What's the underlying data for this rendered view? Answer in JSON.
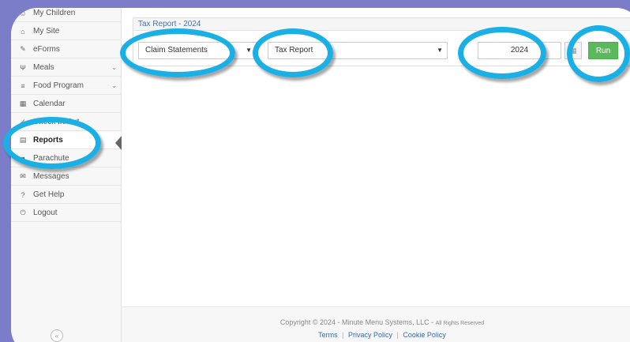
{
  "sidebar": {
    "items": [
      {
        "label": "My Children",
        "icon": "child-icon"
      },
      {
        "label": "My Site",
        "icon": "site-icon"
      },
      {
        "label": "eForms",
        "icon": "edit-icon"
      },
      {
        "label": "Meals",
        "icon": "utensils-icon",
        "expandable": true
      },
      {
        "label": "Food Program",
        "icon": "food-program-icon",
        "expandable": true
      },
      {
        "label": "Calendar",
        "icon": "calendar-icon"
      },
      {
        "label": "Check In/Out",
        "icon": "check-icon"
      },
      {
        "label": "Reports",
        "icon": "report-icon",
        "active": true
      },
      {
        "label": "Parachute",
        "icon": "parachute-icon"
      },
      {
        "label": "Messages",
        "icon": "envelope-icon"
      },
      {
        "label": "Get Help",
        "icon": "help-icon"
      },
      {
        "label": "Logout",
        "icon": "power-icon"
      }
    ],
    "collapse_label": "«"
  },
  "report": {
    "title": "Tax Report - 2024",
    "category_value": "Claim Statements",
    "report_value": "Tax Report",
    "year_value": "2024",
    "run_label": "Run"
  },
  "footer": {
    "copyright": "Copyright © 2024 - Minute Menu Systems, LLC -",
    "rights": "All Rights Reserved",
    "links": {
      "terms": "Terms",
      "privacy": "Privacy Policy",
      "cookie": "Cookie Policy"
    }
  },
  "colors": {
    "accent": "#1ab0e6",
    "run": "#5cb85c",
    "background": "#7b7dc8"
  }
}
